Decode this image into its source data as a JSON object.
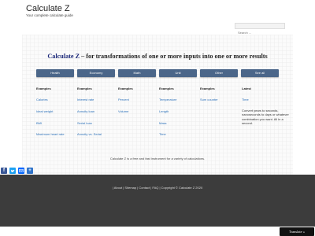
{
  "header": {
    "site_title": "Calculate Z",
    "tagline": "Your complete calculate guide",
    "search_placeholder": "Search ..."
  },
  "hero": {
    "brand": "Calculate Z",
    "rest": " – for transformations of one or more inputs into one or more results"
  },
  "categories": [
    "Health",
    "Economy",
    "Math",
    "Unit",
    "Other",
    "See all"
  ],
  "columns": [
    {
      "heading": "Examples",
      "links": [
        "Calories",
        "Ideal weight",
        "BMI",
        "Maximum heart rate"
      ]
    },
    {
      "heading": "Examples",
      "links": [
        "Interest rate",
        "Annuity loan",
        "Serial loan",
        "Annuity vs. Serial"
      ]
    },
    {
      "heading": "Examples",
      "links": [
        "Percent",
        "Volume"
      ]
    },
    {
      "heading": "Examples",
      "links": [
        "Temperature",
        "Length",
        "Mass",
        "Time"
      ]
    },
    {
      "heading": "Examples",
      "links": [
        "Sum counter"
      ]
    },
    {
      "heading": "Latest",
      "links": [
        "Time"
      ]
    }
  ],
  "latest_description": "Convert years to seconds, nanoseconds to days or whatever combination you want. All in a second.",
  "free_note": "Calculate Z is a free and fast instrument for a variety of calculations.",
  "share_icons": [
    "facebook-icon",
    "twitter-icon",
    "email-icon",
    "share-plus-icon"
  ],
  "colors": {
    "button_bg": "#4b6689",
    "link": "#2a6fb8",
    "brand": "#1d2a7a",
    "footer_bg": "#3c3c3c",
    "facebook": "#3b5998",
    "twitter": "#1da1f2",
    "email": "#0166ff",
    "share": "#2f73c9"
  },
  "footer": {
    "links_text": "| About | Sitemap | Contact | FAQ | Copyright © Calculate Z 2020"
  },
  "translate": {
    "label": "Translate »"
  }
}
